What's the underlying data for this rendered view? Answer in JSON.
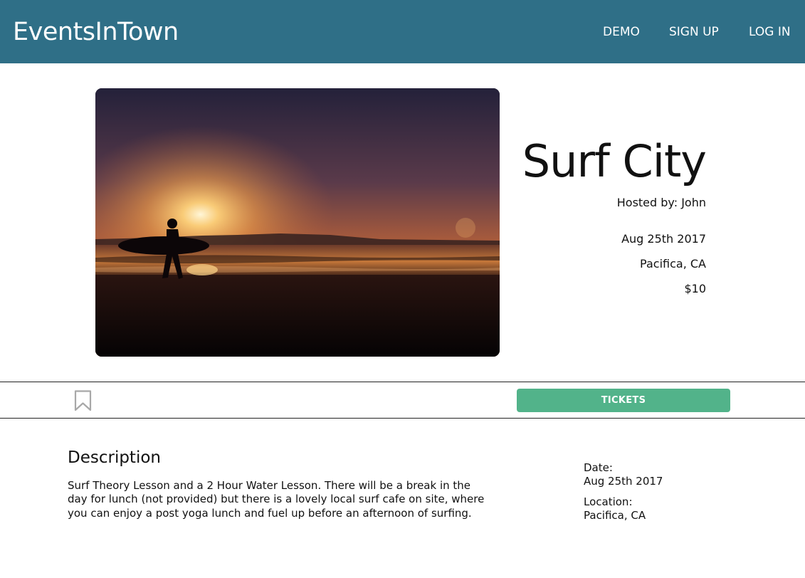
{
  "navbar": {
    "brand": "EventsInTown",
    "links": [
      "DEMO",
      "SIGN UP",
      "LOG IN"
    ]
  },
  "event": {
    "title": "Surf City",
    "host": "Hosted by: John",
    "date": "Aug 25th 2017",
    "location": "Pacifica, CA",
    "price": "$10"
  },
  "actions": {
    "bookmark_icon": "bookmark-icon",
    "tickets_label": "TICKETS"
  },
  "description": {
    "heading": "Description",
    "text": "Surf Theory Lesson and a 2 Hour Water Lesson. There will be a break in the day for lunch (not provided) but there is a lovely local surf cafe on site, where you can enjoy a post yoga lunch and fuel up before an afternoon of surfing."
  },
  "details": {
    "date_label": "Date:",
    "date_value": "Aug 25th 2017",
    "location_label": "Location:",
    "location_value": "Pacifica, CA"
  },
  "colors": {
    "navbar": "#2f6f87",
    "accent": "#52b38a"
  }
}
